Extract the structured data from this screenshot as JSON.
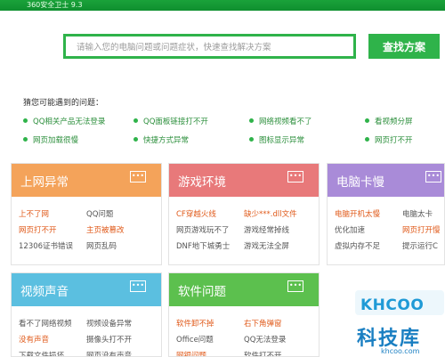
{
  "window": {
    "title": "360安全卫士 9.3"
  },
  "search": {
    "placeholder": "请输入您的电脑问题或问题症状，快速查找解决方案",
    "button_label": "查找方案"
  },
  "problems": {
    "title": "猜您可能遇到的问题：",
    "items": [
      "QQ相关产品无法登录",
      "QQ面板链接打不开",
      "网络视频看不了",
      "看视频分屏",
      "网页加载很慢",
      "快捷方式异常",
      "图标显示异常",
      "网页打不开"
    ]
  },
  "cards": [
    {
      "title": "上网异常",
      "color": "#f4a35a",
      "links": [
        {
          "text": "上不了网",
          "hot": true
        },
        {
          "text": "QQ问题",
          "hot": false
        },
        {
          "text": "网页打不开",
          "hot": true
        },
        {
          "text": "主页被篡改",
          "hot": true
        },
        {
          "text": "12306证书错误",
          "hot": false
        },
        {
          "text": "网页乱码",
          "hot": false
        }
      ]
    },
    {
      "title": "游戏环境",
      "color": "#e8797a",
      "links": [
        {
          "text": "CF穿越火线",
          "hot": true
        },
        {
          "text": "缺少***.dll文件",
          "hot": true
        },
        {
          "text": "网页游戏玩不了",
          "hot": false
        },
        {
          "text": "游戏经常掉线",
          "hot": false
        },
        {
          "text": "DNF地下城勇士",
          "hot": false
        },
        {
          "text": "游戏无法全屏",
          "hot": false
        }
      ]
    },
    {
      "title": "电脑卡慢",
      "color": "#a98bd8",
      "links": [
        {
          "text": "电脑开机太慢",
          "hot": true
        },
        {
          "text": "电脑太卡",
          "hot": false
        },
        {
          "text": "优化加速",
          "hot": false
        },
        {
          "text": "网页打开慢",
          "hot": true
        },
        {
          "text": "虚拟内存不足",
          "hot": false
        },
        {
          "text": "提示运行C",
          "hot": false
        }
      ]
    },
    {
      "title": "视频声音",
      "color": "#5bbfe0",
      "links": [
        {
          "text": "看不了网络视频",
          "hot": false
        },
        {
          "text": "视频设备异常",
          "hot": false
        },
        {
          "text": "没有声音",
          "hot": true
        },
        {
          "text": "摄像头打不开",
          "hot": false
        },
        {
          "text": "下载文件损坏",
          "hot": false
        },
        {
          "text": "网页没有声音",
          "hot": false
        }
      ]
    },
    {
      "title": "软件问题",
      "color": "#5cc04e",
      "links": [
        {
          "text": "软件卸不掉",
          "hot": true
        },
        {
          "text": "右下角弹窗",
          "hot": true
        },
        {
          "text": "Office问题",
          "hot": false
        },
        {
          "text": "QQ无法登录",
          "hot": false
        },
        {
          "text": "网银问题",
          "hot": true
        },
        {
          "text": "软件打不开",
          "hot": false
        }
      ]
    }
  ],
  "watermark": {
    "word": "KHCOO",
    "cn": "科技库",
    "url": "khcoo.com"
  }
}
